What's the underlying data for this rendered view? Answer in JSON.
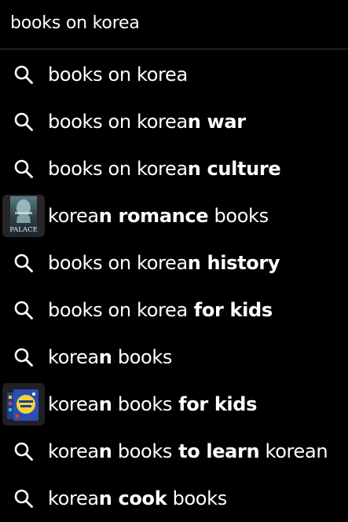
{
  "search": {
    "value": "books on korea"
  },
  "suggestions": [
    {
      "icon": "search-icon",
      "prefix": "books on korea",
      "bold": "",
      "suffix": ""
    },
    {
      "icon": "search-icon",
      "prefix": "books on korea",
      "bold": "n war",
      "suffix": ""
    },
    {
      "icon": "search-icon",
      "prefix": "books on korea",
      "bold": "n culture",
      "suffix": ""
    },
    {
      "icon": "book-cover-thumbnail",
      "prefix": "korea",
      "bold": "n romance",
      "suffix": " books",
      "thumb_text": "PALACE"
    },
    {
      "icon": "search-icon",
      "prefix": "books on korea",
      "bold": "n history",
      "suffix": ""
    },
    {
      "icon": "search-icon",
      "prefix": "books on korea",
      "bold": " for kids",
      "suffix": ""
    },
    {
      "icon": "search-icon",
      "prefix": "korea",
      "bold": "n",
      "suffix": " books"
    },
    {
      "icon": "book-set-thumbnail",
      "prefix": "korea",
      "bold": "n",
      "suffix": " books",
      "bold2": " for kids"
    },
    {
      "icon": "search-icon",
      "prefix": "korea",
      "bold": "n",
      "suffix": " books",
      "bold2": " to learn",
      "suffix2": " korean"
    },
    {
      "icon": "search-icon",
      "prefix": "korea",
      "bold": "n cook",
      "suffix": " books"
    }
  ],
  "colors": {
    "background": "#000000",
    "text": "#ffffff",
    "divider": "#3a3a3a"
  }
}
